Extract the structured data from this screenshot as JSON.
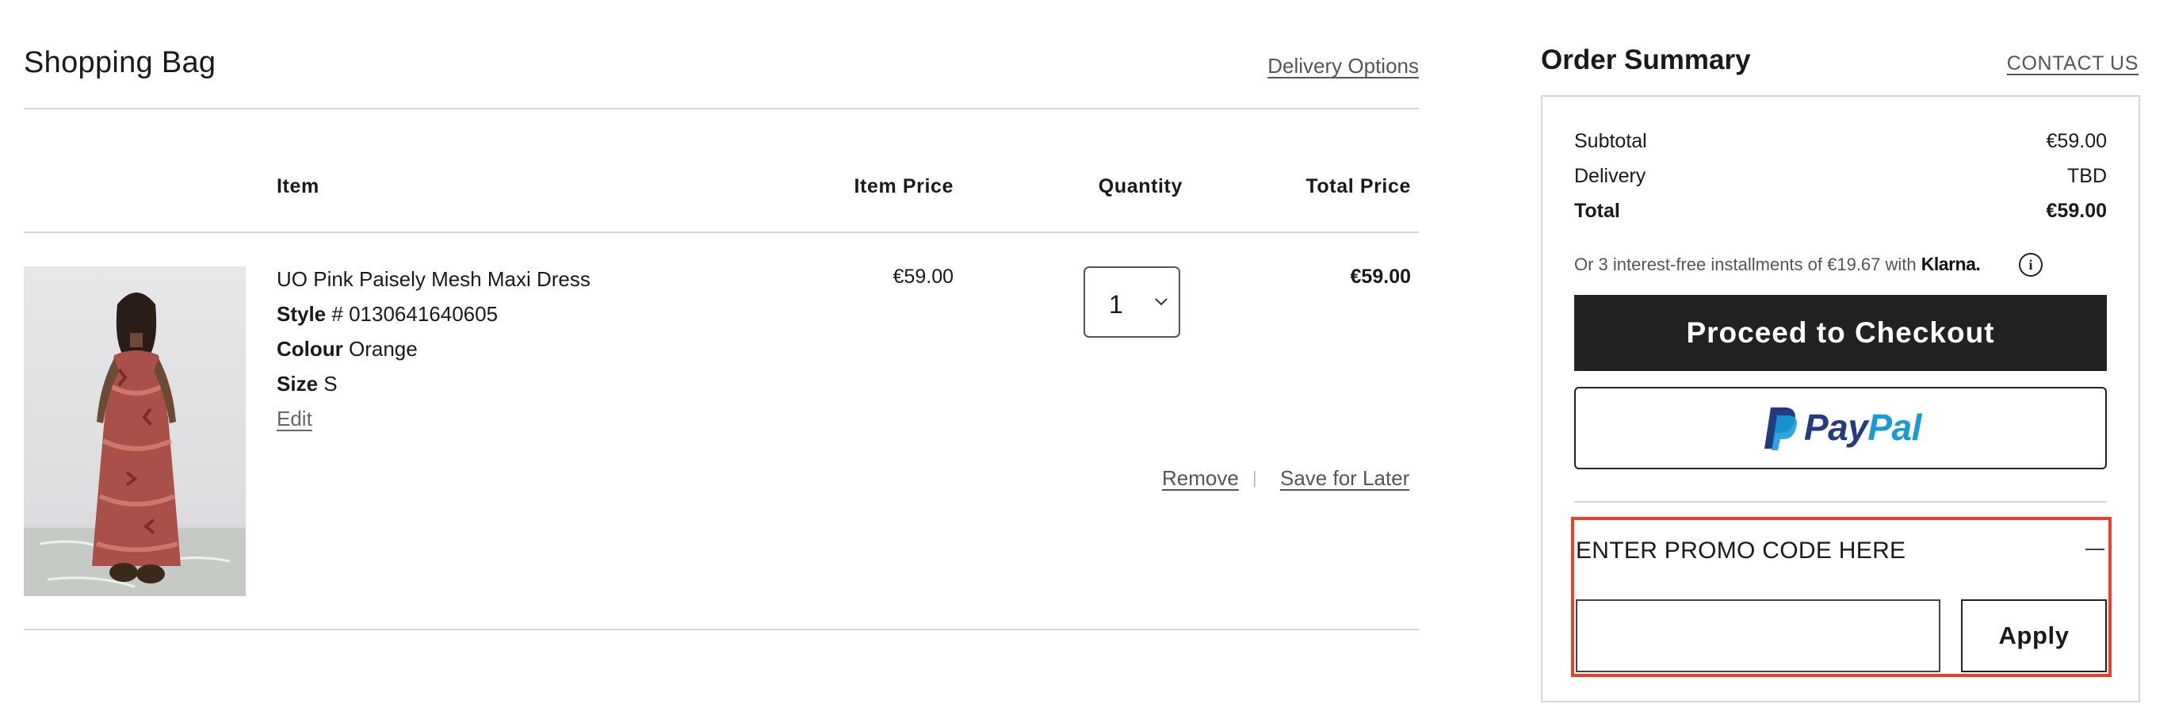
{
  "cart": {
    "title": "Shopping Bag",
    "delivery_options_link": "Delivery Options",
    "columns": {
      "item": "Item",
      "item_price": "Item Price",
      "quantity": "Quantity",
      "total_price": "Total Price"
    },
    "item": {
      "name": "UO Pink Paisely Mesh Maxi Dress",
      "style_label": "Style",
      "style_value": "# 0130641640605",
      "colour_label": "Colour",
      "colour_value": "Orange",
      "size_label": "Size",
      "size_value": "S",
      "edit_link": "Edit",
      "item_price": "€59.00",
      "quantity": "1",
      "total_price": "€59.00",
      "remove_link": "Remove",
      "separator": "|",
      "save_for_later_link": "Save for Later"
    }
  },
  "summary": {
    "title": "Order Summary",
    "contact_link": "CONTACT US",
    "subtotal_label": "Subtotal",
    "subtotal_value": "€59.00",
    "delivery_label": "Delivery",
    "delivery_value": "TBD",
    "total_label": "Total",
    "total_value": "€59.00",
    "klarna_text": "Or 3 interest-free installments of €19.67 with",
    "klarna_brand": "Klarna.",
    "info_icon_glyph": "i",
    "checkout_label": "Proceed to Checkout",
    "paypal_part1": "Pay",
    "paypal_part2": "Pal"
  },
  "promo": {
    "label": "ENTER PROMO CODE HERE",
    "input_value": "",
    "input_placeholder": "",
    "apply_label": "Apply"
  },
  "colors": {
    "checkout_bg": "#222222",
    "highlight_outline": "#e8402a",
    "paypal_dark": "#253b80",
    "paypal_light": "#179bd7"
  }
}
